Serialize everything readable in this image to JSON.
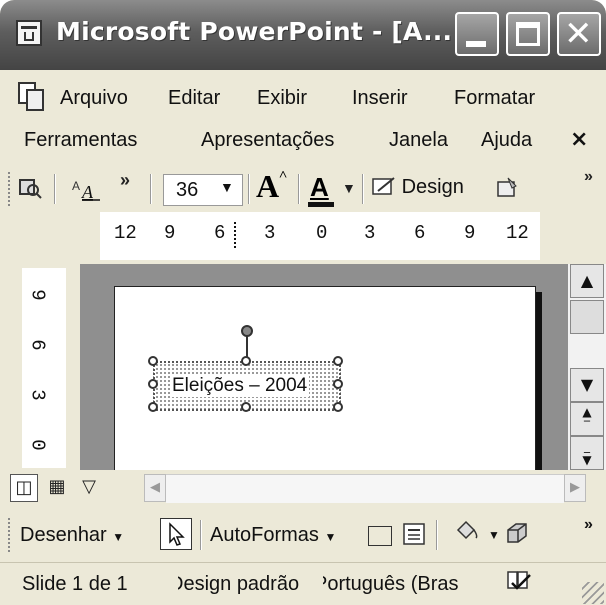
{
  "window": {
    "title": "Microsoft PowerPoint - [A...",
    "close_glyph": "✕"
  },
  "menu": {
    "row1": [
      "Arquivo",
      "Editar",
      "Exibir",
      "Inserir",
      "Formatar"
    ],
    "row2": [
      "Ferramentas",
      "Apresentações",
      "Janela",
      "Ajuda"
    ],
    "doc_close": "×"
  },
  "toolbar": {
    "more_glyph": "»",
    "font_size": "36",
    "design_label": "Design",
    "icons": [
      "research-icon",
      "font-style-icon",
      "increase-font-size-icon",
      "font-color-icon",
      "design-icon",
      "new-slide-icon"
    ]
  },
  "ruler": {
    "horizontal": [
      "12",
      "9",
      "6",
      "3",
      "0",
      "3",
      "6",
      "9",
      "12"
    ],
    "vertical": [
      "9",
      "6",
      "3",
      "0"
    ]
  },
  "slide": {
    "textbox_text": "Eleições – 2004"
  },
  "draw_toolbar": {
    "draw_label": "Desenhar",
    "autoshapes_label": "AutoFormas"
  },
  "status": {
    "slide": "Slide 1 de 1",
    "design": "Design padrão",
    "language": "Português (Bras"
  },
  "colors": {
    "titlebar": "#5e5e5e",
    "chrome": "#ece9d8",
    "workspace": "#8f8f8f"
  }
}
